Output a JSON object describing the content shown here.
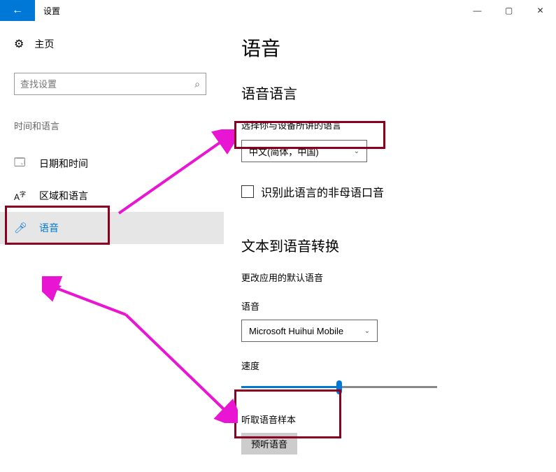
{
  "titlebar": {
    "app_title": "设置"
  },
  "sidebar": {
    "home_label": "主页",
    "search_placeholder": "查找设置",
    "section_label": "时间和语言",
    "nav": [
      {
        "label": "日期和时间"
      },
      {
        "label": "区域和语言"
      },
      {
        "label": "语音"
      }
    ]
  },
  "content": {
    "page_title": "语音",
    "speech_lang_section": "语音语言",
    "speech_lang_desc": "选择你与设备所讲的语言",
    "lang_combo_value": "中文(简体，中国)",
    "checkbox_label": "识别此语言的非母语口音",
    "tts_section": "文本到语音转换",
    "tts_desc": "更改应用的默认语音",
    "voice_label": "语音",
    "voice_combo_value": "Microsoft Huihui Mobile",
    "speed_label": "速度",
    "sample_label": "听取语音样本",
    "preview_btn": "预听语音"
  }
}
